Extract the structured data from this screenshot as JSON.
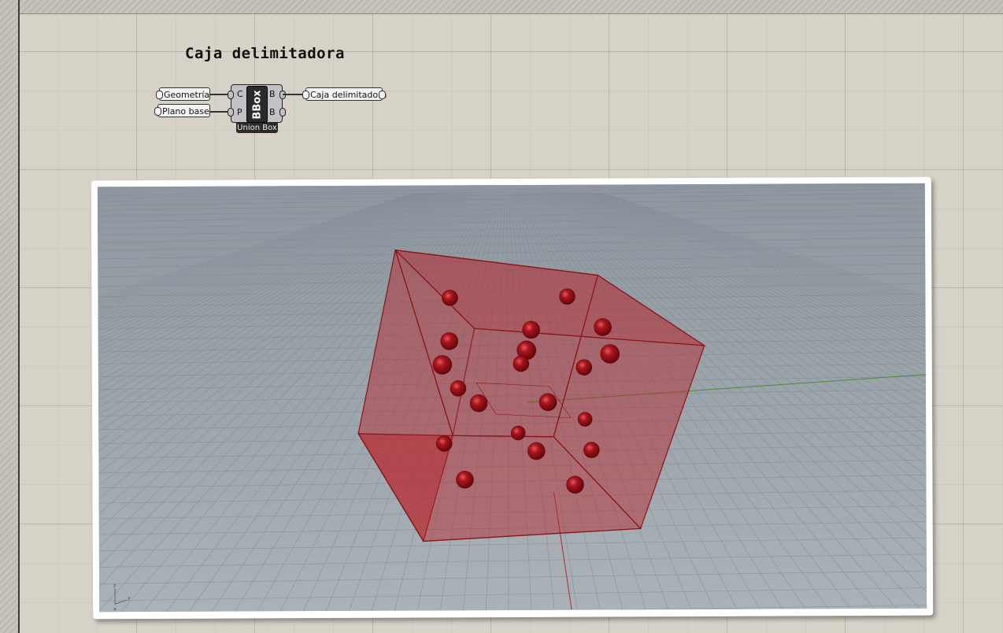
{
  "canvas": {
    "group_title": "Caja delimitadora"
  },
  "component": {
    "inputs": [
      {
        "param_label": "Geometría",
        "port": "C"
      },
      {
        "param_label": "Plano base",
        "port": "P"
      }
    ],
    "core_label": "BBox",
    "outputs": [
      {
        "port": "B",
        "param_label": "Caja delimitadora"
      },
      {
        "port": "B"
      }
    ],
    "name": "Union Box"
  },
  "viewport": {
    "colors": {
      "box_fill": "#b81f26",
      "box_edge": "#8a1418",
      "sphere": "#9e1016",
      "background": "#9aa3ab",
      "grid": "#8b949c",
      "axis_green": "#4a8a3a",
      "axis_red": "#b0282c"
    },
    "axis_icon_labels": [
      "z",
      "y",
      "x"
    ]
  }
}
